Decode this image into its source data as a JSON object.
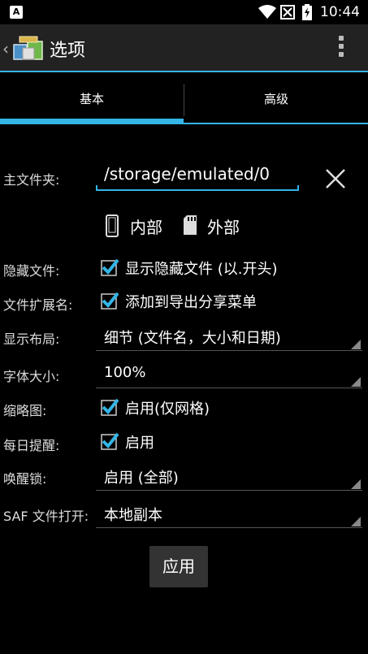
{
  "status_bar": {
    "app_indicator": "A",
    "time": "10:44"
  },
  "action_bar": {
    "title": "选项"
  },
  "tabs": [
    {
      "label": "基本",
      "selected": true
    },
    {
      "label": "高级",
      "selected": false
    }
  ],
  "main_folder": {
    "label": "主文件夹:",
    "value": "/storage/emulated/0"
  },
  "storage": {
    "internal": "内部",
    "external": "外部"
  },
  "hidden_files": {
    "label": "隐藏文件:",
    "checkbox_label": "显示隐藏文件 (以.开头)",
    "checked": true
  },
  "file_extension": {
    "label": "文件扩展名:",
    "checkbox_label": "添加到导出分享菜单",
    "checked": true
  },
  "display_layout": {
    "label": "显示布局:",
    "value": "细节 (文件名，大小和日期)"
  },
  "font_size": {
    "label": "字体大小:",
    "value": "100%"
  },
  "thumbnails": {
    "label": "缩略图:",
    "checkbox_label": "启用(仅网格)",
    "checked": true
  },
  "daily_reminder": {
    "label": "每日提醒:",
    "checkbox_label": "启用",
    "checked": true
  },
  "wake_lock": {
    "label": "唤醒锁:",
    "value": "启用 (全部)"
  },
  "saf_open": {
    "label": "SAF 文件打开:",
    "value": "本地副本"
  },
  "apply_button": "应用",
  "colors": {
    "accent": "#33b5e5",
    "background": "#000000",
    "action_bar": "#222222"
  }
}
